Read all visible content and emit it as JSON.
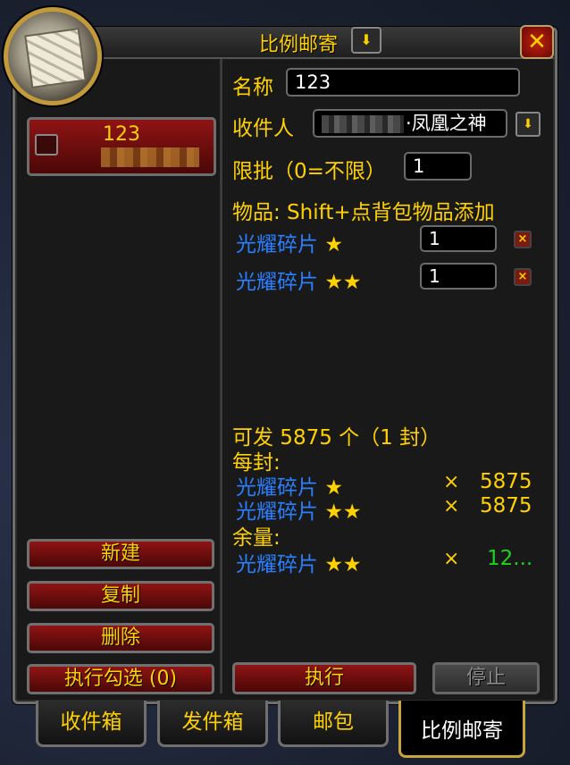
{
  "window": {
    "title": "比例邮寄"
  },
  "recipient_card": {
    "number": "123"
  },
  "form": {
    "name_label": "名称",
    "name_value": "123",
    "recipient_label": "收件人",
    "recipient_value": "·凤凰之神",
    "limit_label": "限批（0=不限）",
    "limit_value": "1",
    "items_label": "物品: Shift+点背包物品添加",
    "items": [
      {
        "name": "光耀碎片",
        "stars": "★",
        "qty": "1"
      },
      {
        "name": "光耀碎片",
        "stars": "★★",
        "qty": "1"
      }
    ]
  },
  "summary": {
    "sendable": "可发 5875 个（1 封）",
    "per_letter_label": "每封:",
    "per_letter": [
      {
        "name": "光耀碎片",
        "stars": "★",
        "times": "×",
        "count": "5875"
      },
      {
        "name": "光耀碎片",
        "stars": "★★",
        "times": "×",
        "count": "5875"
      }
    ],
    "remaining_label": "余量:",
    "remaining": [
      {
        "name": "光耀碎片",
        "stars": "★★",
        "times": "×",
        "count": "12..."
      }
    ]
  },
  "left_buttons": {
    "new": "新建",
    "copy": "复制",
    "delete": "删除",
    "run_checked": "执行勾选 (0)"
  },
  "right_buttons": {
    "execute": "执行",
    "stop": "停止"
  },
  "tabs": [
    {
      "label": "收件箱",
      "active": false
    },
    {
      "label": "发件箱",
      "active": false
    },
    {
      "label": "邮包",
      "active": false
    },
    {
      "label": "比例邮寄",
      "active": true
    }
  ],
  "colors": {
    "gold": "#ffd100",
    "item_blue": "#2a7fff",
    "remaining_green": "#20d020"
  }
}
